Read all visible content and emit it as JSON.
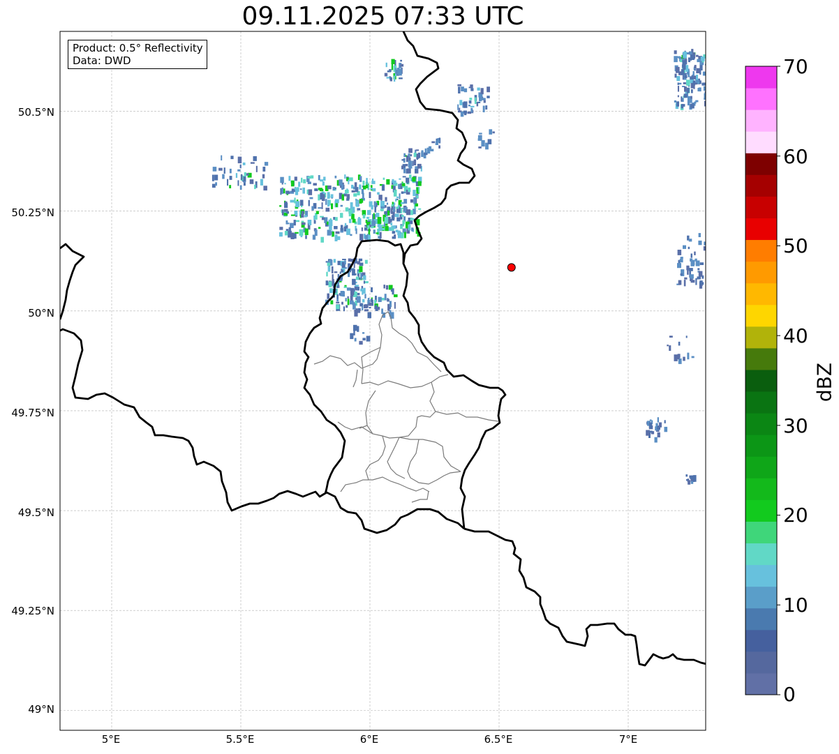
{
  "title": "09.11.2025 07:33 UTC",
  "info_box": {
    "product": "Product: 0.5° Reflectivity",
    "data_source": "Data: DWD"
  },
  "map": {
    "lon_range": [
      4.8,
      7.3
    ],
    "lat_range": [
      48.95,
      50.7
    ],
    "x_ticks": [
      "5°E",
      "5.5°E",
      "6°E",
      "6.5°E",
      "7°E"
    ],
    "y_ticks": [
      "50.5°N",
      "50.25°N",
      "50°N",
      "49.75°N",
      "49.5°N",
      "49.25°N",
      "49°N"
    ],
    "gridlines": true,
    "radar_marker": {
      "lon": 6.548,
      "lat": 50.109,
      "color": "#ff0000"
    }
  },
  "colorbar": {
    "label": "dBZ",
    "ticks": [
      "70",
      "60",
      "50",
      "40",
      "30",
      "20",
      "10",
      "0"
    ],
    "range": [
      0,
      70
    ],
    "colors": [
      "#6170a6",
      "#55689e",
      "#45609e",
      "#4a7aaf",
      "#5a9ec9",
      "#67c1dd",
      "#61d8c6",
      "#3fd67a",
      "#12ca1e",
      "#13b91b",
      "#0fa618",
      "#0c9616",
      "#0b8614",
      "#0a7412",
      "#0a5e0e",
      "#467a0c",
      "#b1b30a",
      "#fed600",
      "#ffb800",
      "#ff9a00",
      "#ff7d00",
      "#e80000",
      "#c80000",
      "#a50000",
      "#7e0000",
      "#ffdcff",
      "#ffb3ff",
      "#ff72ff",
      "#ee38ee"
    ]
  }
}
